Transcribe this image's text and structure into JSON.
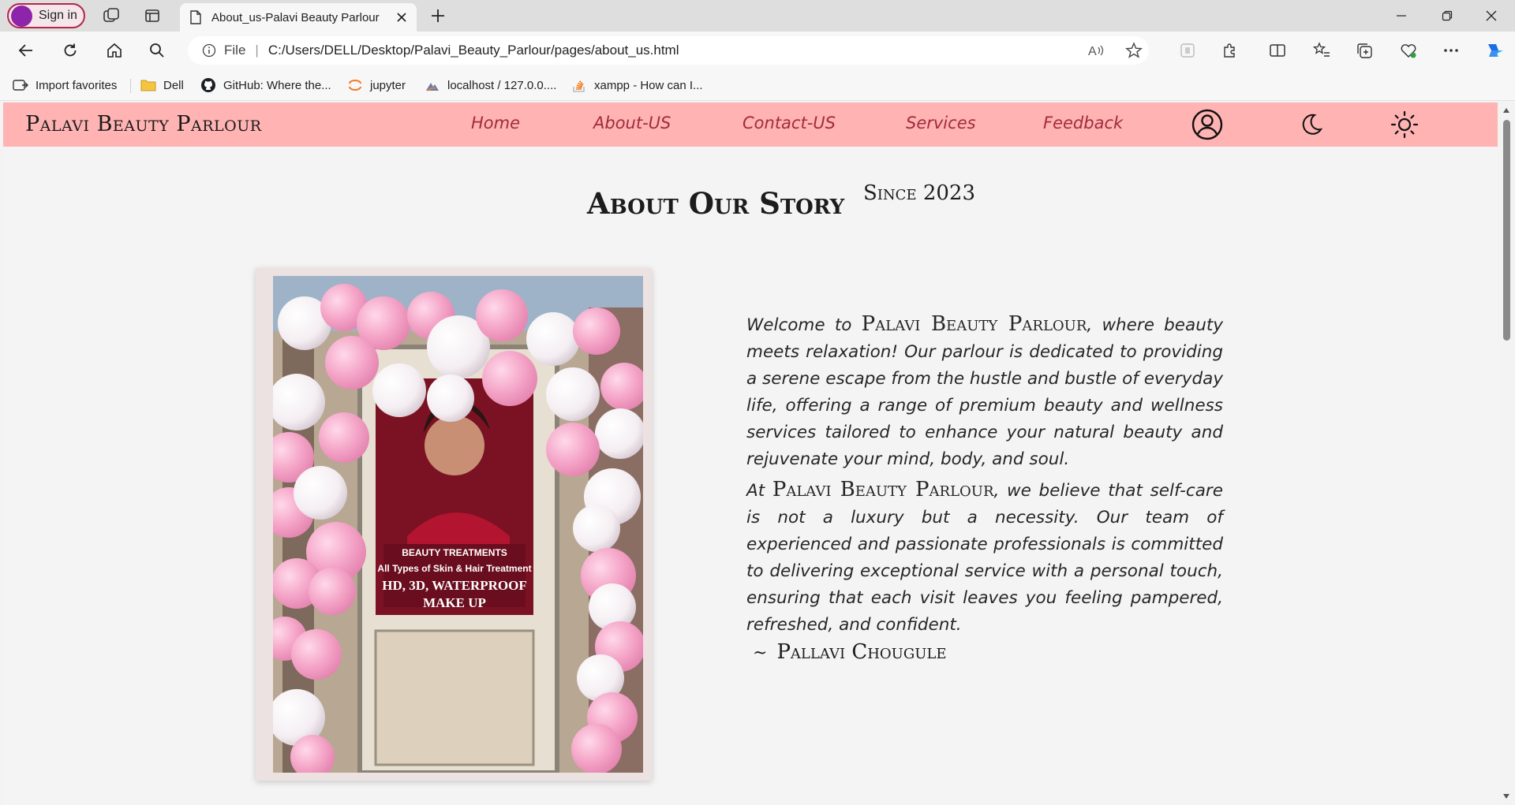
{
  "browser": {
    "signin_label": "Sign in",
    "tab_title": "About_us-Palavi Beauty Parlour",
    "address": {
      "scheme_label": "File",
      "url": "C:/Users/DELL/Desktop/Palavi_Beauty_Parlour/pages/about_us.html"
    },
    "favorites": [
      {
        "label": "Import favorites",
        "icon": "import-icon"
      },
      {
        "label": "Dell",
        "icon": "folder-icon"
      },
      {
        "label": "GitHub: Where the...",
        "icon": "github-icon"
      },
      {
        "label": "jupyter",
        "icon": "jupyter-icon"
      },
      {
        "label": "localhost / 127.0.0....",
        "icon": "phpmyadmin-icon"
      },
      {
        "label": "xampp - How can I...",
        "icon": "stackoverflow-icon"
      }
    ]
  },
  "site": {
    "brand": "Palavi Beauty Parlour",
    "nav": [
      "Home",
      "About-US",
      "Contact-US",
      "Services",
      "Feedback"
    ],
    "accent_color": "#ffb3b3",
    "link_color": "#a12c3e"
  },
  "about": {
    "title": "About Our Story",
    "since": "Since 2023",
    "photo_sign": {
      "line1": "BEAUTY TREATMENTS",
      "line2": "All Types of Skin & Hair Treatment",
      "line3": "HD, 3D, WATERPROOF",
      "line4": "MAKE UP"
    },
    "p1_pre": "Welcome to",
    "p1_brand": "Palavi Beauty Parlour",
    "p1_post": ", where beauty meets relaxation! Our parlour is dedicated to providing a serene escape from the hustle and bustle of everyday life, offering a range of premium beauty and wellness services tailored to enhance your natural beauty and rejuvenate your mind, body, and soul.",
    "p2_pre": "At",
    "p2_brand": "Palavi Beauty Parlour",
    "p2_post": ", we believe that self-care is not a luxury but a necessity. Our team of experienced and passionate professionals is committed to delivering exceptional service with a personal touch, ensuring that each visit leaves you feeling pampered, refreshed, and confident.",
    "signature_tilde": "~",
    "signature": "Pallavi Chougule"
  }
}
